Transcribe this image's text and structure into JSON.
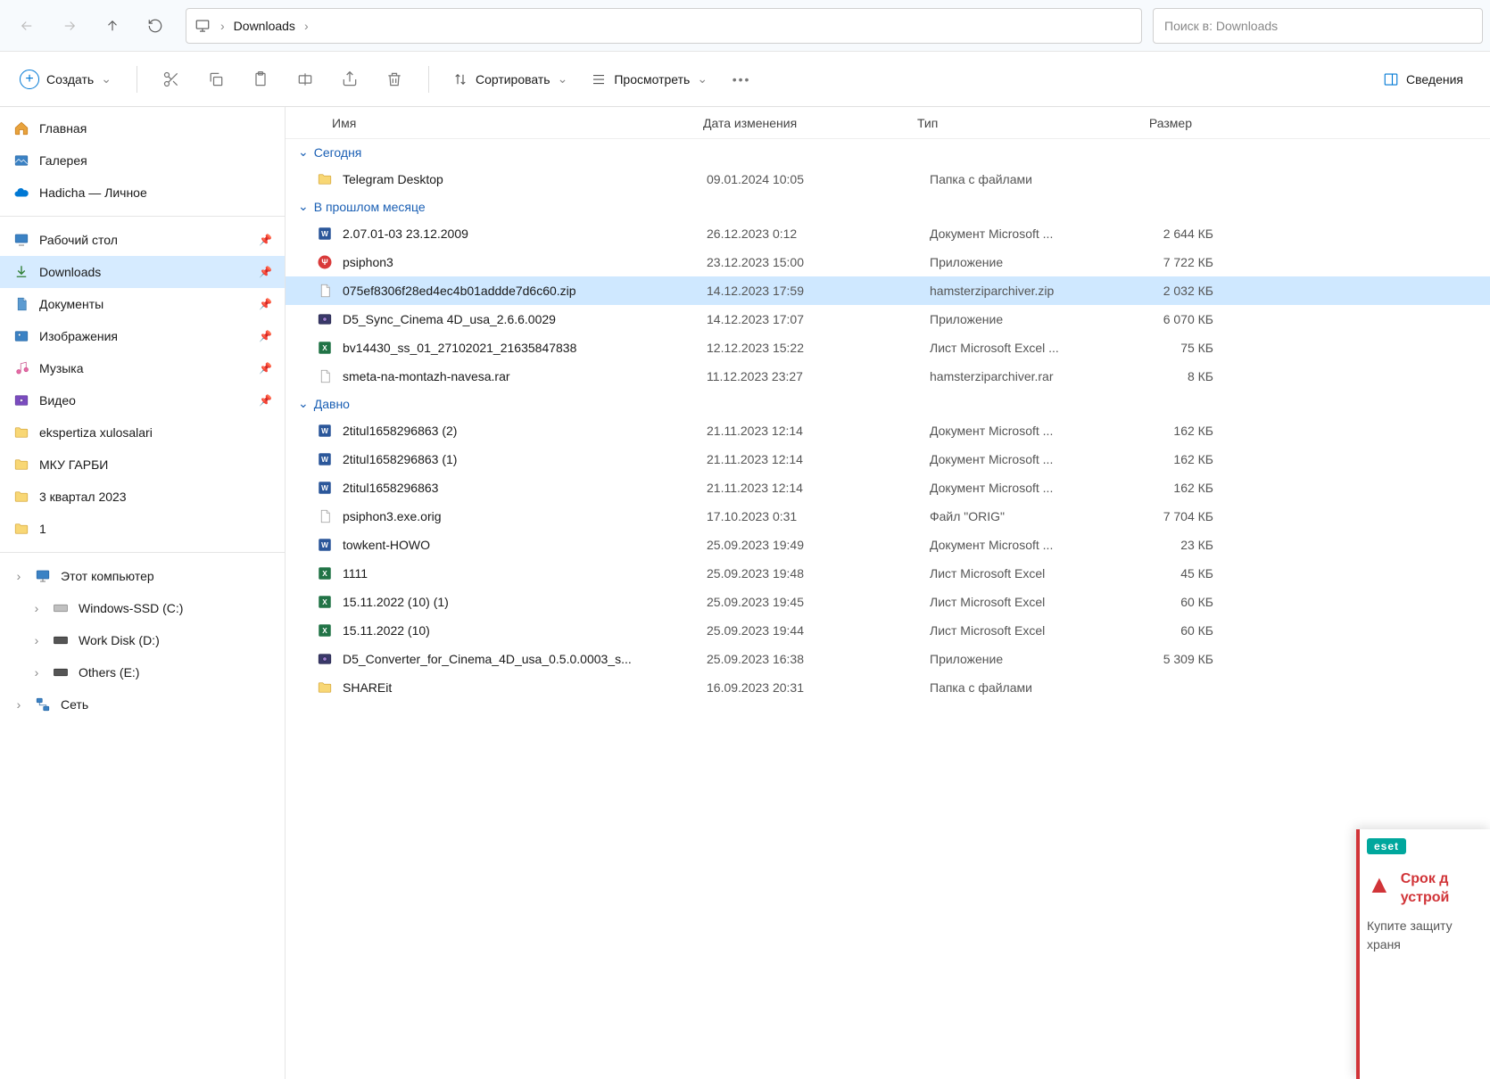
{
  "addressbar": {
    "location": "Downloads",
    "search_placeholder": "Поиск в: Downloads"
  },
  "toolbar": {
    "new_label": "Создать",
    "sort_label": "Сортировать",
    "view_label": "Просмотреть",
    "details_label": "Сведения"
  },
  "sidebar": {
    "home": "Главная",
    "gallery": "Галерея",
    "onedrive": "Hadicha — Личное",
    "quick": [
      {
        "label": "Рабочий стол",
        "pin": true,
        "icon": "desktop"
      },
      {
        "label": "Downloads",
        "pin": true,
        "icon": "downloads",
        "selected": true
      },
      {
        "label": "Документы",
        "pin": true,
        "icon": "documents"
      },
      {
        "label": "Изображения",
        "pin": true,
        "icon": "pictures"
      },
      {
        "label": "Музыка",
        "pin": true,
        "icon": "music"
      },
      {
        "label": "Видео",
        "pin": true,
        "icon": "videos"
      },
      {
        "label": "ekspertiza xulosalari",
        "pin": false,
        "icon": "folder"
      },
      {
        "label": "МКУ ГАРБИ",
        "pin": false,
        "icon": "folder"
      },
      {
        "label": "3 квартал 2023",
        "pin": false,
        "icon": "folder"
      },
      {
        "label": "1",
        "pin": false,
        "icon": "folder"
      }
    ],
    "thispc": "Этот компьютер",
    "drives": [
      {
        "label": "Windows-SSD (C:)",
        "icon": "ssd"
      },
      {
        "label": "Work Disk (D:)",
        "icon": "hdd"
      },
      {
        "label": "Others (E:)",
        "icon": "hdd"
      }
    ],
    "network": "Сеть"
  },
  "columns": {
    "name": "Имя",
    "date": "Дата изменения",
    "type": "Тип",
    "size": "Размер"
  },
  "groups": [
    {
      "title": "Сегодня",
      "items": [
        {
          "icon": "folder",
          "name": "Telegram Desktop",
          "date": "09.01.2024 10:05",
          "type": "Папка с файлами",
          "size": ""
        }
      ]
    },
    {
      "title": "В прошлом месяце",
      "items": [
        {
          "icon": "word",
          "name": "2.07.01-03 23.12.2009",
          "date": "26.12.2023 0:12",
          "type": "Документ Microsoft ...",
          "size": "2 644 КБ"
        },
        {
          "icon": "psiphon",
          "name": "psiphon3",
          "date": "23.12.2023 15:00",
          "type": "Приложение",
          "size": "7 722 КБ"
        },
        {
          "icon": "file",
          "name": "075ef8306f28ed4ec4b01addde7d6c60.zip",
          "date": "14.12.2023 17:59",
          "type": "hamsterziparchiver.zip",
          "size": "2 032 КБ",
          "selected": true
        },
        {
          "icon": "c4d",
          "name": "D5_Sync_Cinema 4D_usa_2.6.6.0029",
          "date": "14.12.2023 17:07",
          "type": "Приложение",
          "size": "6 070 КБ"
        },
        {
          "icon": "excel",
          "name": "bv14430_ss_01_27102021_21635847838",
          "date": "12.12.2023 15:22",
          "type": "Лист Microsoft Excel ...",
          "size": "75 КБ"
        },
        {
          "icon": "file",
          "name": "smeta-na-montazh-navesa.rar",
          "date": "11.12.2023 23:27",
          "type": "hamsterziparchiver.rar",
          "size": "8 КБ"
        }
      ]
    },
    {
      "title": "Давно",
      "items": [
        {
          "icon": "word",
          "name": "2titul1658296863 (2)",
          "date": "21.11.2023 12:14",
          "type": "Документ Microsoft ...",
          "size": "162 КБ"
        },
        {
          "icon": "word",
          "name": "2titul1658296863 (1)",
          "date": "21.11.2023 12:14",
          "type": "Документ Microsoft ...",
          "size": "162 КБ"
        },
        {
          "icon": "word",
          "name": "2titul1658296863",
          "date": "21.11.2023 12:14",
          "type": "Документ Microsoft ...",
          "size": "162 КБ"
        },
        {
          "icon": "file",
          "name": "psiphon3.exe.orig",
          "date": "17.10.2023 0:31",
          "type": "Файл \"ORIG\"",
          "size": "7 704 КБ"
        },
        {
          "icon": "word",
          "name": "towkent-HOWO",
          "date": "25.09.2023 19:49",
          "type": "Документ Microsoft ...",
          "size": "23 КБ"
        },
        {
          "icon": "excel",
          "name": "1111",
          "date": "25.09.2023 19:48",
          "type": "Лист Microsoft Excel",
          "size": "45 КБ"
        },
        {
          "icon": "excel",
          "name": "15.11.2022 (10) (1)",
          "date": "25.09.2023 19:45",
          "type": "Лист Microsoft Excel",
          "size": "60 КБ"
        },
        {
          "icon": "excel",
          "name": "15.11.2022 (10)",
          "date": "25.09.2023 19:44",
          "type": "Лист Microsoft Excel",
          "size": "60 КБ"
        },
        {
          "icon": "c4d",
          "name": "D5_Converter_for_Cinema_4D_usa_0.5.0.0003_s...",
          "date": "25.09.2023 16:38",
          "type": "Приложение",
          "size": "5 309 КБ"
        },
        {
          "icon": "folder",
          "name": "SHAREit",
          "date": "16.09.2023 20:31",
          "type": "Папка с файлами",
          "size": ""
        }
      ]
    }
  ],
  "eset": {
    "logo": "eset",
    "title1": "Срок д",
    "title2": "устрой",
    "body": "Купите защиту храня"
  }
}
